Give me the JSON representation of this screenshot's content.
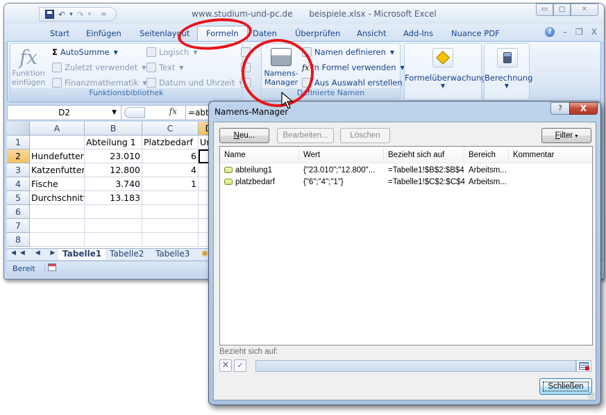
{
  "window": {
    "site": "www.studium-und-pc.de",
    "title": "beispiele.xlsx - Microsoft Excel",
    "controls": {
      "minimize": "▭",
      "maximize": "▢",
      "close": "✕"
    }
  },
  "quick_access": {
    "save": "save-icon",
    "undo": "↶",
    "undo_dd": "▾",
    "redo": "↷",
    "redo_dd": "▾",
    "customize": "="
  },
  "ribbon_tabs": [
    "Start",
    "Einfügen",
    "Seitenlayout",
    "Formeln",
    "Daten",
    "Überprüfen",
    "Ansicht",
    "Add-Ins",
    "Nuance PDF"
  ],
  "active_tab": "Formeln",
  "ribbon_right": {
    "help": "?",
    "minimize": "–",
    "restore": "❐",
    "close": "X"
  },
  "groups": {
    "funktionsbibliothek": {
      "label": "Funktionsbibliothek",
      "insert_function": {
        "icon": "fx",
        "line1": "Funktion",
        "line2": "einfügen"
      },
      "autosumme": {
        "icon": "Σ",
        "label": "AutoSumme"
      },
      "zuletzt": "Zuletzt verwendet",
      "finanz": "Finanzmathematik",
      "logisch": "Logisch",
      "text": "Text",
      "datum": "Datum und Uhrzeit"
    },
    "definierte_namen": {
      "label": "Definierte Namen",
      "manager": {
        "line1": "Namens-",
        "line2": "Manager"
      },
      "definieren": "Namen definieren",
      "in_formel": "In Formel verwenden",
      "aus_auswahl": "Aus Auswahl erstellen"
    },
    "formelueberwachung": {
      "label": "Formelüberwachung"
    },
    "berechnung": {
      "label": "Berechnung"
    }
  },
  "formula_bar": {
    "name_box": "D2",
    "fx": "fx",
    "formula": "=abte"
  },
  "sheet": {
    "columns": [
      "A",
      "B",
      "C",
      "D"
    ],
    "rows": [
      {
        "n": "1",
        "cells": [
          "",
          "Abteilung 1",
          "Platzbedarf",
          "Um"
        ]
      },
      {
        "n": "2",
        "cells": [
          "Hundefutter",
          "23.010",
          "6",
          ""
        ]
      },
      {
        "n": "3",
        "cells": [
          "Katzenfutter",
          "12.800",
          "4",
          ""
        ]
      },
      {
        "n": "4",
        "cells": [
          "Fische",
          "3.740",
          "1",
          ""
        ]
      },
      {
        "n": "5",
        "cells": [
          "Durchschnitt",
          "13.183",
          "",
          ""
        ]
      },
      {
        "n": "6",
        "cells": [
          "",
          "",
          "",
          ""
        ]
      },
      {
        "n": "7",
        "cells": [
          "",
          "",
          "",
          ""
        ]
      },
      {
        "n": "8",
        "cells": [
          "",
          "",
          "",
          ""
        ]
      }
    ],
    "selected_cell": "D2",
    "tabs": [
      "Tabelle1",
      "Tabelle2",
      "Tabelle3"
    ],
    "active_sheet": "Tabelle1",
    "nav": "◀◀ ◀ ▶ ▶▶"
  },
  "status": {
    "text": "Bereit"
  },
  "dialog": {
    "title": "Namens-Manager",
    "help": "?",
    "close": "X",
    "buttons": {
      "neu_u": "N",
      "neu_rest": "eu...",
      "bearbeiten": "Bearbeiten...",
      "loeschen": "Löschen",
      "filter_u": "F",
      "filter_rest": "ilter",
      "filter_dd": "▾"
    },
    "columns": [
      "Name",
      "Wert",
      "Bezieht sich auf",
      "Bereich",
      "Kommentar"
    ],
    "rows": [
      {
        "name": "abteilung1",
        "wert": "{\"23.010\";\"12.800\"...",
        "bezug": "=Tabelle1!$B$2:$B$4",
        "bereich": "Arbeitsm...",
        "kommentar": ""
      },
      {
        "name": "platzbedarf",
        "wert": "{\"6\";\"4\";\"1\"}",
        "bezug": "=Tabelle1!$C$2:$C$4",
        "bereich": "Arbeitsm...",
        "kommentar": ""
      }
    ],
    "ref_label": "Bezieht sich auf:",
    "ref_value": "",
    "cancel_glyph": "✕",
    "ok_glyph": "✓",
    "close_button": "Schließen"
  },
  "annotation_color": "#e8141a"
}
